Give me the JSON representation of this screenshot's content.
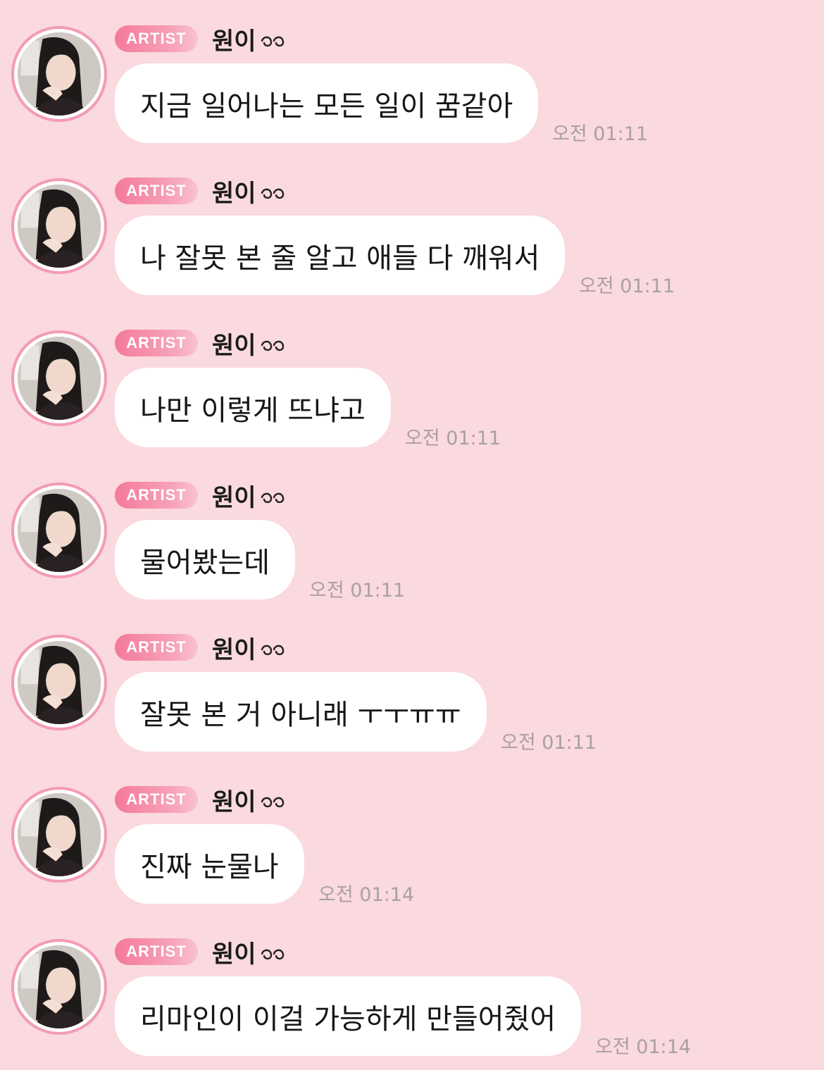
{
  "badge_label": "ARTIST",
  "sender_name": "원이",
  "colors": {
    "background": "#fad9df",
    "bubble": "#ffffff",
    "badge_start": "#f4799a",
    "avatar_ring": "#f39bb6",
    "timestamp": "#a9a0a3"
  },
  "icons": {
    "name_suffix": "ears-icon"
  },
  "messages": [
    {
      "text": "지금 일어나는 모든 일이 꿈같아",
      "time": "오전 01:11"
    },
    {
      "text": "나 잘못 본 줄 알고 애들 다 깨워서",
      "time": "오전 01:11"
    },
    {
      "text": "나만 이렇게 뜨냐고",
      "time": "오전 01:11"
    },
    {
      "text": "물어봤는데",
      "time": "오전 01:11"
    },
    {
      "text": "잘못 본 거 아니래 ㅜㅜㅠㅠ",
      "time": "오전 01:11"
    },
    {
      "text": "진짜 눈물나",
      "time": "오전 01:14"
    },
    {
      "text": "리마인이 이걸 가능하게 만들어줬어",
      "time": "오전 01:14"
    }
  ]
}
